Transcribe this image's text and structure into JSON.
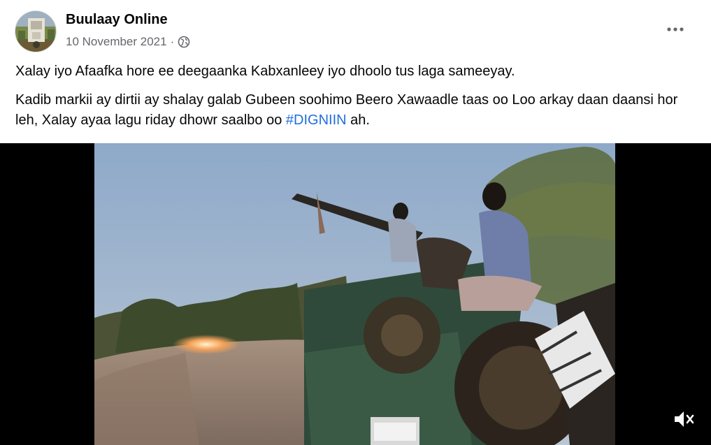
{
  "post": {
    "page_name": "Buulaay Online",
    "date": "10 November 2021",
    "separator": "·",
    "privacy_icon": "globe-icon",
    "more_icon": "more-options-icon",
    "text_line1": "Xalay iyo Afaafka hore ee deegaanka Kabxanleey iyo dhoolo tus laga sameeyay.",
    "text_line2_before": "Kadib markii ay dirtii ay shalay galab Gubeen soohimo Beero Xawaadle taas oo Loo arkay daan daansi hor leh, Xalay ayaa lagu riday dhowr saalbo oo ",
    "hashtag": "#DIGNIIN",
    "text_line2_after": " ah."
  },
  "video": {
    "mute_icon": "muted-speaker-icon"
  },
  "colors": {
    "text": "#050505",
    "secondary_text": "#65676b",
    "link": "#216fdb",
    "video_background": "#000000"
  }
}
